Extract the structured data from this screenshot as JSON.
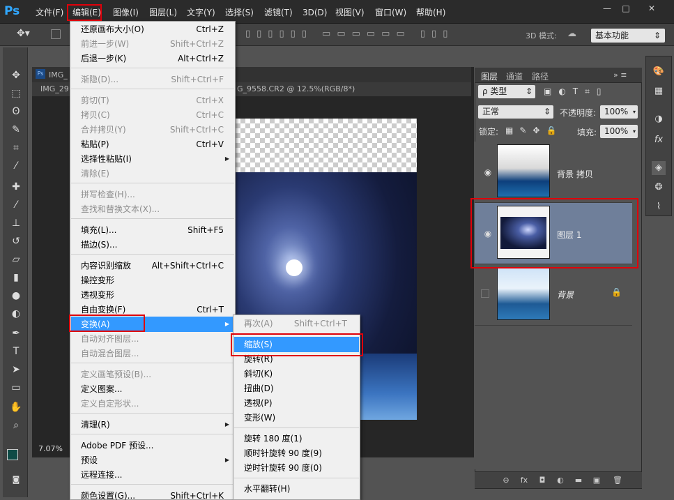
{
  "app": {
    "logo": "Ps"
  },
  "menubar": {
    "items": [
      "文件(F)",
      "编辑(E)",
      "图像(I)",
      "图层(L)",
      "文字(Y)",
      "选择(S)",
      "滤镜(T)",
      "3D(D)",
      "视图(V)",
      "窗口(W)",
      "帮助(H)"
    ],
    "window_controls": [
      "—",
      "□",
      "✕"
    ]
  },
  "options": {
    "mode_label": "3D 模式:",
    "workspace": "基本功能"
  },
  "document": {
    "tab_title": "IMG_",
    "subtab_left": "IMG_29",
    "subtab_right": "G_9558.CR2 @ 12.5%(RGB/8*)",
    "zoom": "7.07%"
  },
  "edit_menu": {
    "items": [
      {
        "label": "还原画布大小(O)",
        "shortcut": "Ctrl+Z",
        "disabled": false
      },
      {
        "label": "前进一步(W)",
        "shortcut": "Shift+Ctrl+Z",
        "disabled": true
      },
      {
        "label": "后退一步(K)",
        "shortcut": "Alt+Ctrl+Z",
        "disabled": false
      },
      {
        "label": "渐隐(D)...",
        "shortcut": "Shift+Ctrl+F",
        "disabled": true
      },
      {
        "label": "剪切(T)",
        "shortcut": "Ctrl+X",
        "disabled": true
      },
      {
        "label": "拷贝(C)",
        "shortcut": "Ctrl+C",
        "disabled": true
      },
      {
        "label": "合并拷贝(Y)",
        "shortcut": "Shift+Ctrl+C",
        "disabled": true
      },
      {
        "label": "粘贴(P)",
        "shortcut": "Ctrl+V",
        "disabled": false
      },
      {
        "label": "选择性粘贴(I)",
        "shortcut": "",
        "disabled": false,
        "submenu": true
      },
      {
        "label": "清除(E)",
        "shortcut": "",
        "disabled": true
      },
      {
        "label": "拼写检查(H)...",
        "shortcut": "",
        "disabled": true
      },
      {
        "label": "查找和替换文本(X)...",
        "shortcut": "",
        "disabled": true
      },
      {
        "label": "填充(L)...",
        "shortcut": "Shift+F5",
        "disabled": false
      },
      {
        "label": "描边(S)...",
        "shortcut": "",
        "disabled": false
      },
      {
        "label": "内容识别缩放",
        "shortcut": "Alt+Shift+Ctrl+C",
        "disabled": false
      },
      {
        "label": "操控变形",
        "shortcut": "",
        "disabled": false
      },
      {
        "label": "透视变形",
        "shortcut": "",
        "disabled": false
      },
      {
        "label": "自由变换(F)",
        "shortcut": "Ctrl+T",
        "disabled": false
      },
      {
        "label": "变换(A)",
        "shortcut": "",
        "disabled": false,
        "submenu": true,
        "highlighted": true
      },
      {
        "label": "自动对齐图层...",
        "shortcut": "",
        "disabled": true
      },
      {
        "label": "自动混合图层...",
        "shortcut": "",
        "disabled": true
      },
      {
        "label": "定义画笔预设(B)...",
        "shortcut": "",
        "disabled": true
      },
      {
        "label": "定义图案...",
        "shortcut": "",
        "disabled": false
      },
      {
        "label": "定义自定形状...",
        "shortcut": "",
        "disabled": true
      },
      {
        "label": "清理(R)",
        "shortcut": "",
        "disabled": false,
        "submenu": true
      },
      {
        "label": "Adobe PDF 预设...",
        "shortcut": "",
        "disabled": false
      },
      {
        "label": "预设",
        "shortcut": "",
        "disabled": false,
        "submenu": true
      },
      {
        "label": "远程连接...",
        "shortcut": "",
        "disabled": false
      },
      {
        "label": "颜色设置(G)...",
        "shortcut": "Shift+Ctrl+K",
        "disabled": false
      }
    ]
  },
  "transform_submenu": {
    "items": [
      {
        "label": "再次(A)",
        "shortcut": "Shift+Ctrl+T",
        "disabled": true
      },
      {
        "label": "缩放(S)",
        "shortcut": "",
        "highlighted": true
      },
      {
        "label": "旋转(R)",
        "shortcut": ""
      },
      {
        "label": "斜切(K)",
        "shortcut": ""
      },
      {
        "label": "扭曲(D)",
        "shortcut": ""
      },
      {
        "label": "透视(P)",
        "shortcut": ""
      },
      {
        "label": "变形(W)",
        "shortcut": ""
      },
      {
        "label": "旋转 180 度(1)",
        "shortcut": ""
      },
      {
        "label": "顺时针旋转 90 度(9)",
        "shortcut": ""
      },
      {
        "label": "逆时针旋转 90 度(0)",
        "shortcut": ""
      },
      {
        "label": "水平翻转(H)",
        "shortcut": ""
      }
    ]
  },
  "layers_panel": {
    "tabs": [
      "图层",
      "通道",
      "路径"
    ],
    "filter_label": "ρ 类型",
    "blend_mode": "正常",
    "opacity_label": "不透明度:",
    "opacity_value": "100%",
    "lock_label": "锁定:",
    "fill_label": "填充:",
    "fill_value": "100%",
    "layers": [
      {
        "name": "背景 拷贝",
        "visible": true,
        "selected": false
      },
      {
        "name": "图层 1",
        "visible": true,
        "selected": true
      },
      {
        "name": "背景",
        "visible": false,
        "selected": false,
        "locked": true
      }
    ]
  },
  "colors": {
    "highlight": "#3399ff",
    "annotation": "#e0000a",
    "selected_layer": "#6f7f9a"
  }
}
